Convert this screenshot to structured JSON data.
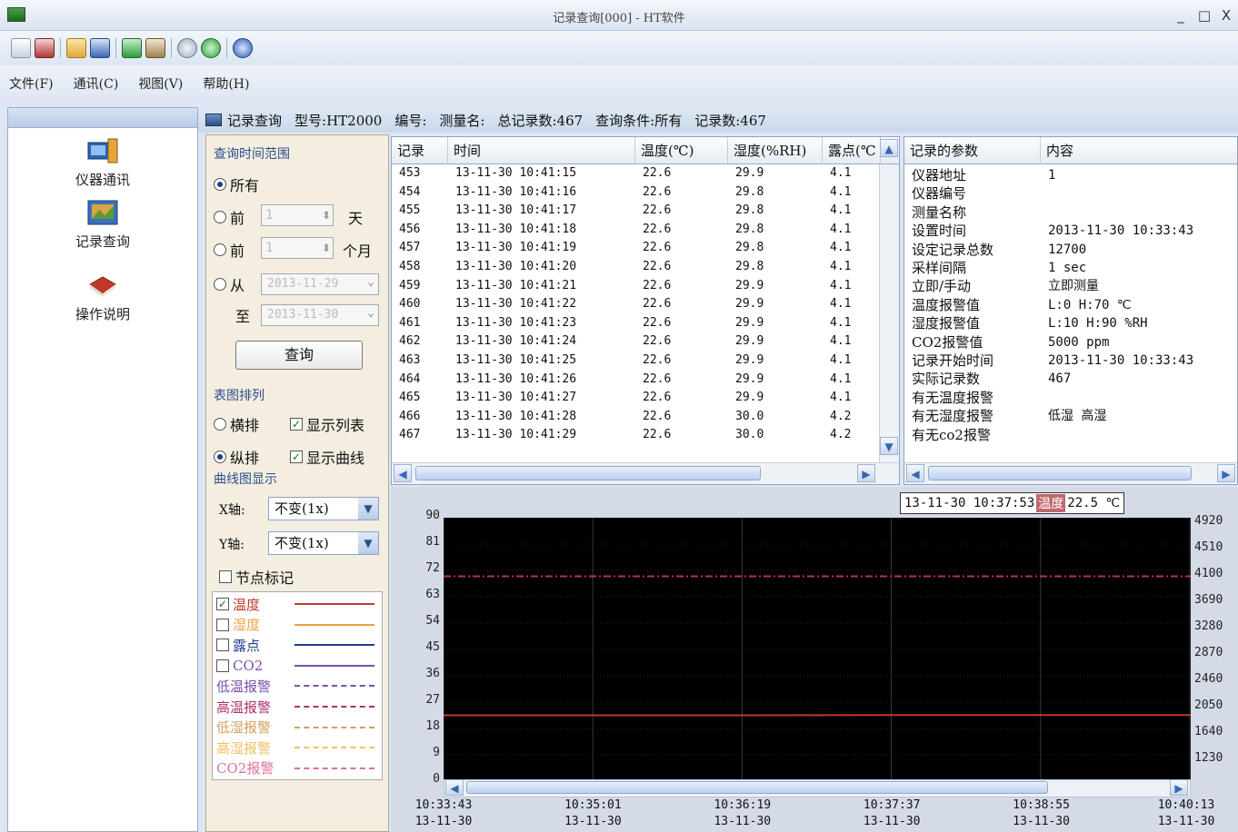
{
  "window": {
    "title": "记录查询[000] - HT软件",
    "controls": {
      "minimize": "_",
      "maximize": "□",
      "close": "X"
    }
  },
  "toolbar": {
    "icons": [
      "grid-icon",
      "table-icon",
      "folder-open-icon",
      "save-icon",
      "export-icon",
      "print-icon",
      "power-icon",
      "refresh-icon",
      "help-icon"
    ]
  },
  "menu": {
    "file": "文件(F)",
    "comm": "通讯(C)",
    "view": "视图(V)",
    "help": "帮助(H)"
  },
  "nav": {
    "items": [
      {
        "label": "仪器通讯",
        "icon": "device-communication-icon"
      },
      {
        "label": "记录查询",
        "icon": "record-query-icon"
      },
      {
        "label": "操作说明",
        "icon": "manual-book-icon"
      }
    ]
  },
  "info": {
    "title": "记录查询",
    "model": "型号:HT2000",
    "serial": "编号:",
    "measure_name": "测量名:",
    "total_records": "总记录数:467",
    "query_condition": "查询条件:所有",
    "record_count": "记录数:467"
  },
  "panel": {
    "time_range_title": "查询时间范围",
    "opt_all": "所有",
    "opt_prev": "前",
    "days_value": "1",
    "days_unit": "天",
    "months_value": "1",
    "months_unit": "个月",
    "opt_from": "从",
    "from_date": "2013-11-29",
    "to_label": "至",
    "to_date": "2013-11-30",
    "query_button": "查询",
    "layout_title": "表图排列",
    "horizontal": "横排",
    "show_list": "显示列表",
    "vertical": "纵排",
    "show_curve": "显示曲线",
    "curve_title": "曲线图显示",
    "x_axis_label": "X轴:",
    "x_axis_value": "不变(1x)",
    "y_axis_label": "Y轴:",
    "y_axis_value": "不变(1x)",
    "node_mark": "节点标记",
    "legend": [
      {
        "label": "温度",
        "checked": true,
        "color": "#c0392b",
        "style": "solid"
      },
      {
        "label": "湿度",
        "checked": false,
        "color": "#f0a040",
        "style": "solid"
      },
      {
        "label": "露点",
        "checked": false,
        "color": "#1f3f8f",
        "style": "solid"
      },
      {
        "label": "CO2",
        "checked": false,
        "color": "#7b4fae",
        "style": "solid"
      },
      {
        "label": "低温报警",
        "checked": false,
        "color": "#7b4fae",
        "style": "dashed"
      },
      {
        "label": "高温报警",
        "checked": false,
        "color": "#b0306a",
        "style": "dashdot"
      },
      {
        "label": "低湿报警",
        "checked": false,
        "color": "#cfa060",
        "style": "dashed"
      },
      {
        "label": "高湿报警",
        "checked": false,
        "color": "#f0c060",
        "style": "dashed"
      },
      {
        "label": "CO2报警",
        "checked": false,
        "color": "#e0709a",
        "style": "dashed"
      }
    ]
  },
  "records": {
    "headers": [
      "记录",
      "时间",
      "温度(℃)",
      "湿度(%RH)",
      "露点(℃"
    ],
    "rows": [
      [
        "453",
        "13-11-30 10:41:15",
        "22.6",
        "29.9",
        "4.1"
      ],
      [
        "454",
        "13-11-30 10:41:16",
        "22.6",
        "29.8",
        "4.1"
      ],
      [
        "455",
        "13-11-30 10:41:17",
        "22.6",
        "29.8",
        "4.1"
      ],
      [
        "456",
        "13-11-30 10:41:18",
        "22.6",
        "29.8",
        "4.1"
      ],
      [
        "457",
        "13-11-30 10:41:19",
        "22.6",
        "29.8",
        "4.1"
      ],
      [
        "458",
        "13-11-30 10:41:20",
        "22.6",
        "29.8",
        "4.1"
      ],
      [
        "459",
        "13-11-30 10:41:21",
        "22.6",
        "29.9",
        "4.1"
      ],
      [
        "460",
        "13-11-30 10:41:22",
        "22.6",
        "29.9",
        "4.1"
      ],
      [
        "461",
        "13-11-30 10:41:23",
        "22.6",
        "29.9",
        "4.1"
      ],
      [
        "462",
        "13-11-30 10:41:24",
        "22.6",
        "29.9",
        "4.1"
      ],
      [
        "463",
        "13-11-30 10:41:25",
        "22.6",
        "29.9",
        "4.1"
      ],
      [
        "464",
        "13-11-30 10:41:26",
        "22.6",
        "29.9",
        "4.1"
      ],
      [
        "465",
        "13-11-30 10:41:27",
        "22.6",
        "29.9",
        "4.1"
      ],
      [
        "466",
        "13-11-30 10:41:28",
        "22.6",
        "30.0",
        "4.2"
      ],
      [
        "467",
        "13-11-30 10:41:29",
        "22.6",
        "30.0",
        "4.2"
      ]
    ]
  },
  "params": {
    "headers": [
      "记录的参数",
      "内容"
    ],
    "rows": [
      [
        "仪器地址",
        "1"
      ],
      [
        "仪器编号",
        ""
      ],
      [
        "测量名称",
        ""
      ],
      [
        "设置时间",
        "2013-11-30 10:33:43"
      ],
      [
        "设定记录总数",
        "12700"
      ],
      [
        "采样间隔",
        "1 sec"
      ],
      [
        "立即/手动",
        "立即测量"
      ],
      [
        "温度报警值",
        "L:0 H:70 ℃"
      ],
      [
        "湿度报警值",
        "L:10 H:90 %RH"
      ],
      [
        "CO2报警值",
        "5000 ppm"
      ],
      [
        "记录开始时间",
        "2013-11-30 10:33:43"
      ],
      [
        "实际记录数",
        "467"
      ],
      [
        "有无温度报警",
        ""
      ],
      [
        "有无湿度报警",
        "低湿 高湿"
      ],
      [
        "有无co2报警",
        ""
      ]
    ]
  },
  "chart_data": {
    "type": "line",
    "title": "",
    "cursor": {
      "time": "13-11-30 10:37:53",
      "series": "温度",
      "value": "22.5 ℃"
    },
    "y_left": {
      "ticks": [
        0,
        9,
        18,
        27,
        36,
        45,
        54,
        63,
        72,
        81,
        90
      ],
      "ylim": [
        0,
        90
      ]
    },
    "y_right": {
      "ticks": [
        1230,
        1640,
        2050,
        2460,
        2870,
        3280,
        3690,
        4100,
        4510,
        4920
      ]
    },
    "x_ticks": [
      {
        "time": "10:33:43",
        "date": "13-11-30"
      },
      {
        "time": "10:35:01",
        "date": "13-11-30"
      },
      {
        "time": "10:36:19",
        "date": "13-11-30"
      },
      {
        "time": "10:37:37",
        "date": "13-11-30"
      },
      {
        "time": "10:38:55",
        "date": "13-11-30"
      },
      {
        "time": "10:40:13",
        "date": "13-11-30"
      }
    ],
    "series": [
      {
        "name": "温度",
        "values": [
          22.5,
          22.5,
          22.5,
          22.6,
          22.6,
          22.6
        ],
        "color": "#c0392b",
        "style": "solid"
      }
    ],
    "reference_lines": [
      {
        "name": "高温报警",
        "value": 70,
        "color": "#b0306a",
        "style": "dashdot"
      }
    ],
    "grid": true,
    "background": "#000000"
  }
}
